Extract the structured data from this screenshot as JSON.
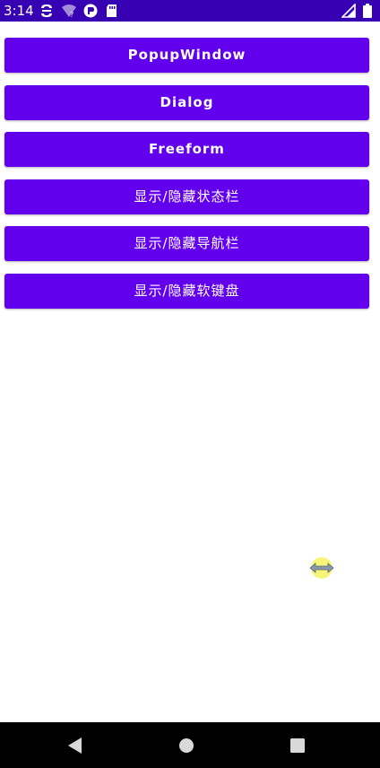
{
  "status_bar": {
    "time": "3:14",
    "background": "#3700b3",
    "icons_left": [
      "sync-icon",
      "wifi-question-icon",
      "app-notification-icon",
      "sd-card-icon"
    ],
    "icons_right": [
      "cellular-signal-icon",
      "battery-icon"
    ]
  },
  "buttons": [
    {
      "label": "PopupWindow"
    },
    {
      "label": "Dialog"
    },
    {
      "label": "Freeform"
    },
    {
      "label": "显示/隐藏状态栏"
    },
    {
      "label": "显示/隐藏导航栏"
    },
    {
      "label": "显示/隐藏软键盘"
    }
  ],
  "colors": {
    "accent": "#6200ee",
    "primary_dark": "#3700b3",
    "background": "#ffffff",
    "nav_bar": "#000000"
  },
  "nav_bar": {
    "icons": [
      "back-icon",
      "home-icon",
      "recents-icon"
    ]
  }
}
